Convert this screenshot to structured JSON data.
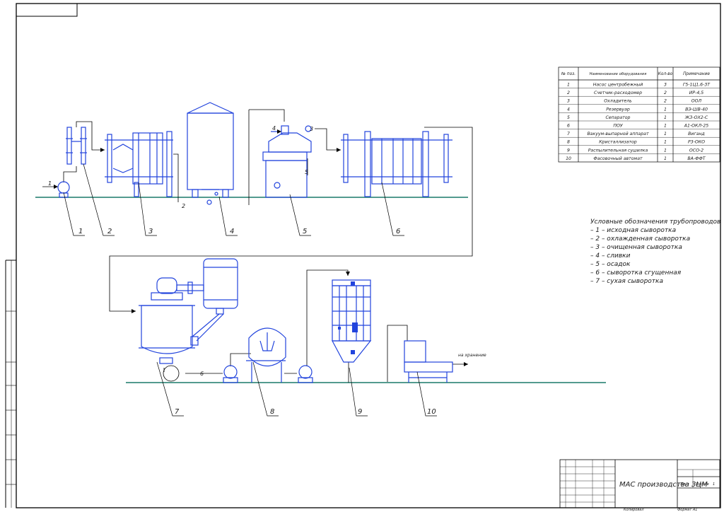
{
  "spec_table": {
    "headers": [
      "№ поз.",
      "Наименование оборудования",
      "Кол-во",
      "Примечание"
    ],
    "rows": [
      [
        "1",
        "Насос центробежный",
        "3",
        "Г5-1Ц1,6-3Т"
      ],
      [
        "2",
        "Счетчик-расходомер",
        "2",
        "ИР-4,5"
      ],
      [
        "3",
        "Охладитель",
        "2",
        "ООЛ"
      ],
      [
        "4",
        "Резервуар",
        "1",
        "ВЭ-ШВ-40"
      ],
      [
        "5",
        "Сепаратор",
        "1",
        "ЖЗ-ОХ2-С"
      ],
      [
        "6",
        "ПОУ",
        "1",
        "А1-ОКЛ-25"
      ],
      [
        "7",
        "Вакуум-выпарной аппарат",
        "1",
        "Виганд"
      ],
      [
        "8",
        "Кристаллизатор",
        "1",
        "Р3-ОКО"
      ],
      [
        "9",
        "Распылительная сушилка",
        "1",
        "ОСО-2"
      ],
      [
        "10",
        "Фасовочный автомат",
        "1",
        "ВА-ФФТ"
      ]
    ]
  },
  "legend": {
    "title": "Условные обозначения трубопроводов",
    "items": [
      "– 1 – исходная сыворотка",
      "– 2 – охлажденная сыворотка",
      "– 3 – очищенная сыворотка",
      "– 4 – сливки",
      "– 5 – осадок",
      "– 6 – сыворотка сгущенная",
      "– 7 – сухая сыворотка"
    ]
  },
  "callouts": {
    "c1": "1",
    "c2": "2",
    "c3": "3",
    "c4": "4",
    "c5": "5",
    "c6": "6",
    "c7": "7",
    "c8": "8",
    "c9": "9",
    "c10": "10"
  },
  "pipe_labels": {
    "p1": "1",
    "p2": "2",
    "p3": "3",
    "p4": "4",
    "p5": "5",
    "p6": "6",
    "to_storage": "на хранение"
  },
  "title_block": {
    "drawing_title": "МАС производства ЗЦМ",
    "sheet_label": "Лист",
    "sheets_label": "Листов",
    "sheets_count": "1",
    "copied": "Копировал",
    "format": "Формат А1"
  }
}
